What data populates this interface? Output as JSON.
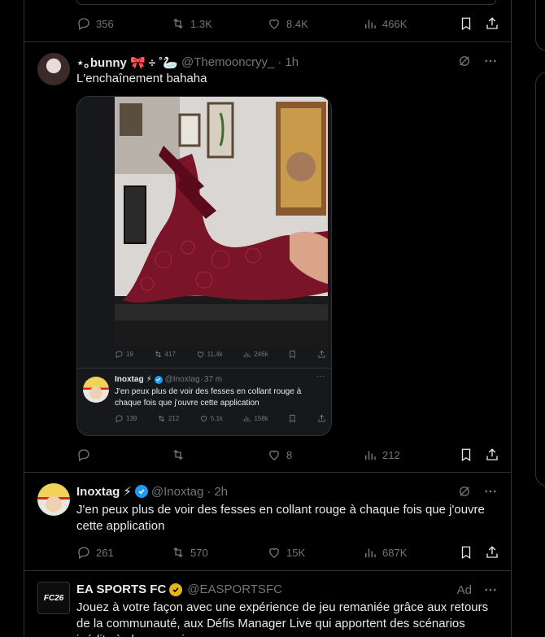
{
  "top_actions": {
    "replies": "356",
    "reposts": "1.3K",
    "likes": "8.4K",
    "views": "466K"
  },
  "post1": {
    "name": "⋆｡bunny 🎀 ÷ ˚🦢",
    "handle": "@Themooncryy_",
    "time": "1h",
    "dot": "·",
    "text": "L'enchaînement bahaha",
    "media_actions": {
      "replies": "19",
      "reposts": "417",
      "likes": "11,4k",
      "views": "246k"
    },
    "inner": {
      "name": "Inoxtag",
      "emoji": "⚡",
      "handle": "@Inoxtag",
      "time": "37 m",
      "dot": "·",
      "text": "J'en peux plus de voir des fesses en collant rouge à chaque fois que j'ouvre cette application",
      "actions": {
        "replies": "139",
        "reposts": "212",
        "likes": "5,1k",
        "views": "158k"
      }
    },
    "actions": {
      "replies": "",
      "reposts": "",
      "likes": "8",
      "views": "212"
    }
  },
  "post2": {
    "name": "Inoxtag",
    "emoji": "⚡",
    "handle": "@Inoxtag",
    "time": "2h",
    "dot": "·",
    "text": "J'en peux plus de voir des fesses en collant rouge à chaque fois que j'ouvre cette application",
    "actions": {
      "replies": "261",
      "reposts": "570",
      "likes": "15K",
      "views": "687K"
    }
  },
  "post3": {
    "name": "EA SPORTS FC",
    "handle": "@EASPORTSFC",
    "ad": "Ad",
    "avatar_text": "FC26",
    "text": "Jouez à votre façon avec une expérience de jeu remaniée grâce aux retours de la communauté, aux Défis Manager Live qui apportent des scénarios inédits à chaque saison"
  },
  "colors": {
    "accent": "#1d9bf0",
    "gold": "#e8b418",
    "muted": "#71767b",
    "border": "#2f3336"
  }
}
